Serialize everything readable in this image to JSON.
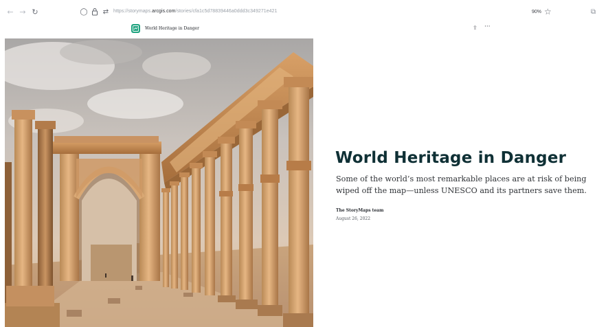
{
  "browser": {
    "url_prefix": "https://storymaps.",
    "url_host": "arcgis.com",
    "url_path": "/stories/cfa1c5d78839446a0ddd3c349271e421",
    "zoom": "90%",
    "back_glyph": "←",
    "forward_glyph": "→",
    "reload_glyph": "↻",
    "shield_glyph": "◯",
    "lock_glyph": "🔒",
    "permissions_glyph": "⇄",
    "star_glyph": "☆",
    "extension_glyph": "⧉"
  },
  "story_header": {
    "title": "World Heritage in Danger",
    "share_glyph": "⇪",
    "more_glyph": "···",
    "logo_color": "#1fa37f"
  },
  "hero": {
    "image_subject": "colonnade-and-arch-photo"
  },
  "story": {
    "title": "World Heritage in Danger",
    "subtitle": "Some of the world’s most remarkable places are at risk of being wiped off the map—unless UNESCO and its partners save them.",
    "author": "The StoryMaps team",
    "date": "August 26, 2022",
    "title_color": "#0f3035"
  }
}
